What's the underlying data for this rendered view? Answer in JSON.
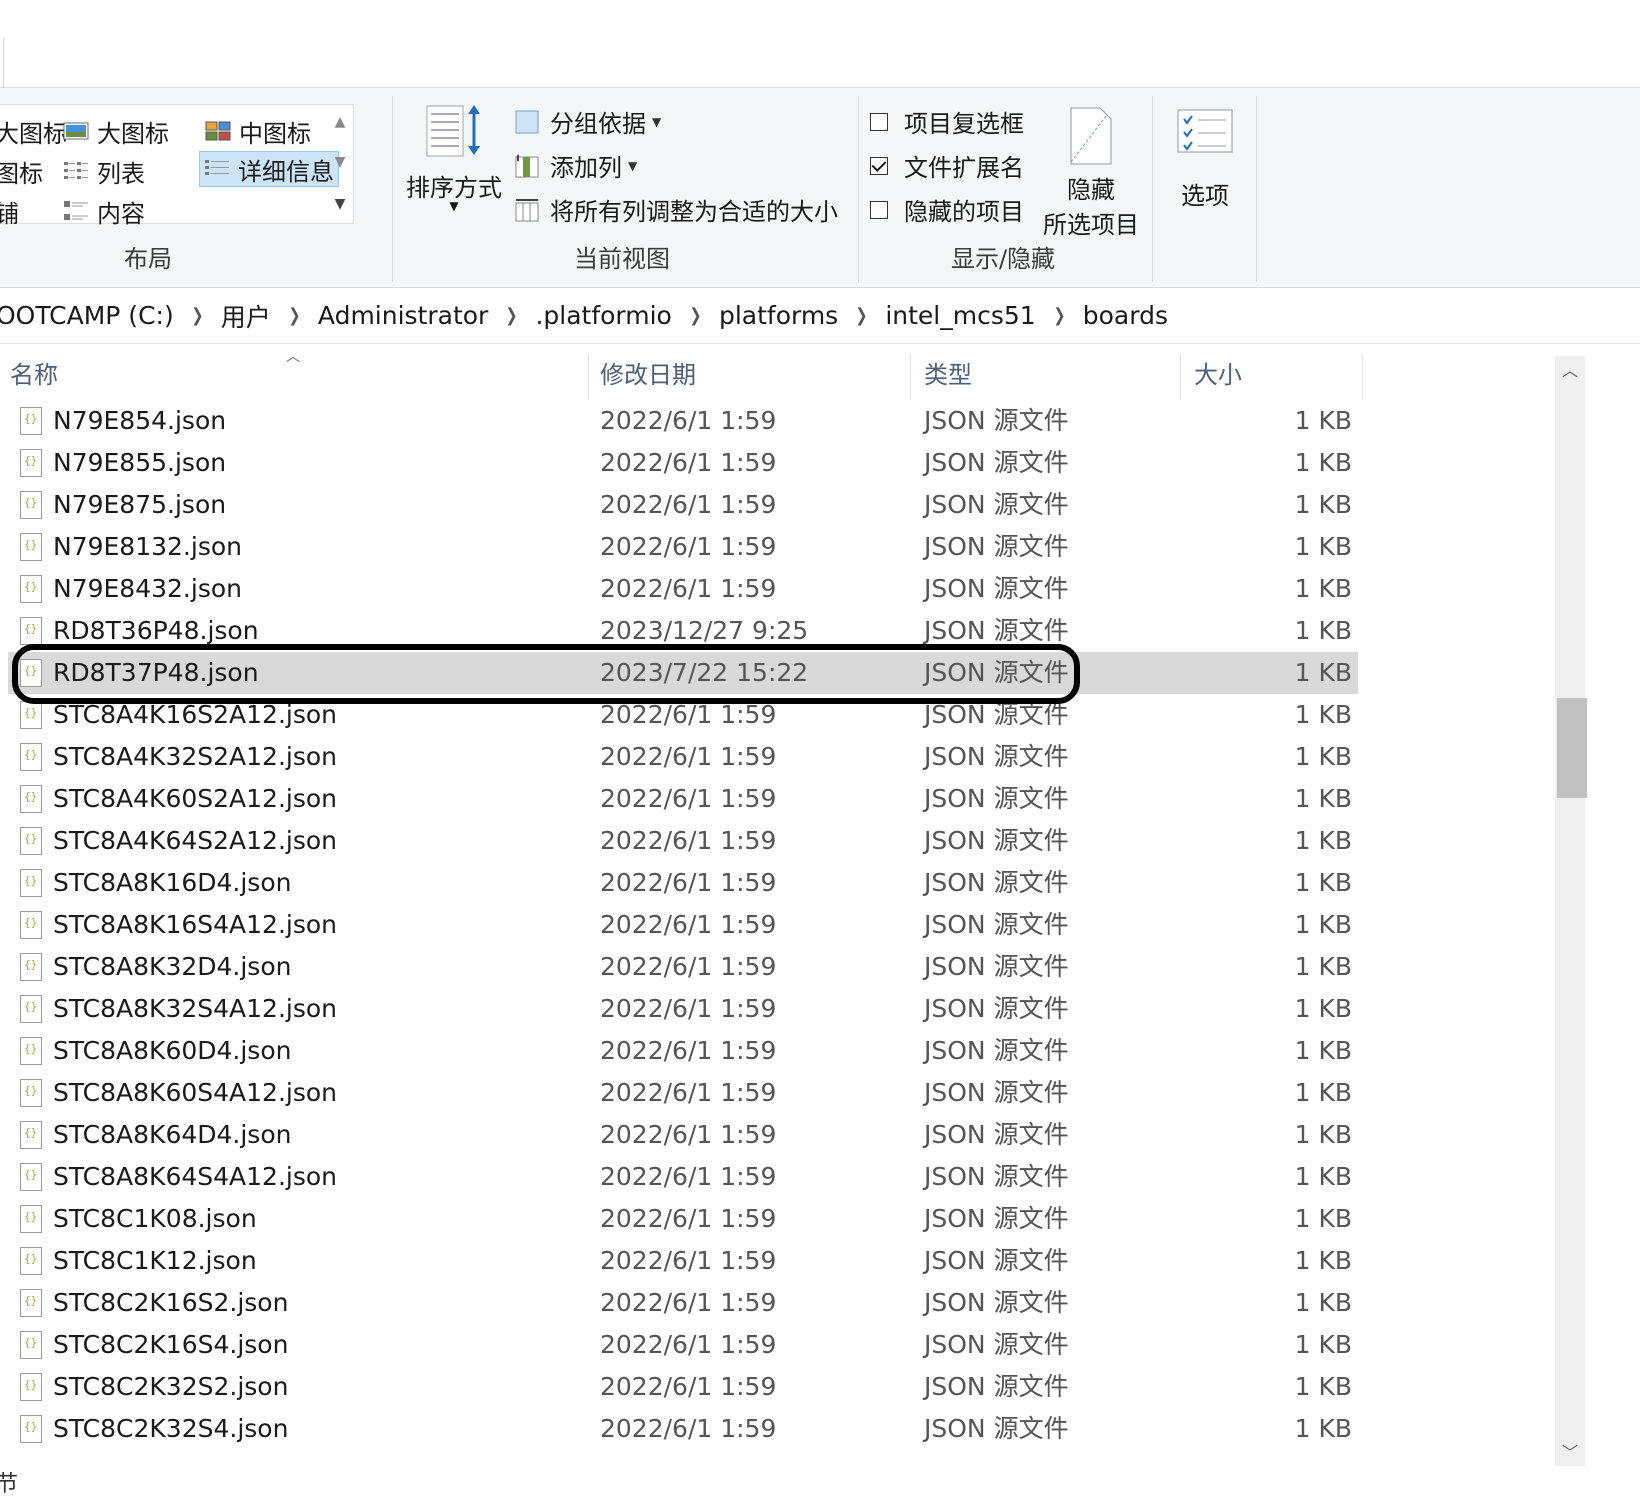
{
  "ribbon": {
    "layout": {
      "label": "布局",
      "items": {
        "partial_large": "大图标",
        "large": "大图标",
        "medium": "中图标",
        "partial_small": "图标",
        "list": "列表",
        "details": "详细信息",
        "partial_tiles": "铺",
        "content": "内容"
      }
    },
    "current_view": {
      "label": "当前视图",
      "sort_by": "排序方式",
      "group_by": "分组依据",
      "add_columns": "添加列",
      "size_all_columns": "将所有列调整为合适的大小"
    },
    "show_hide": {
      "label": "显示/隐藏",
      "item_checkboxes": {
        "label": "项目复选框",
        "checked": false
      },
      "file_extensions": {
        "label": "文件扩展名",
        "checked": true
      },
      "hidden_items": {
        "label": "隐藏的项目",
        "checked": false
      },
      "hide_selected_line1": "隐藏",
      "hide_selected_line2": "所选项目"
    },
    "options": {
      "label": "选项"
    }
  },
  "breadcrumb": [
    "OOTCAMP (C:)",
    "用户",
    "Administrator",
    ".platformio",
    "platforms",
    "intel_mcs51",
    "boards"
  ],
  "columns": {
    "name": "名称",
    "date": "修改日期",
    "type": "类型",
    "size": "大小"
  },
  "files": [
    {
      "name": "N79E854.json",
      "date": "2022/6/1 1:59",
      "type": "JSON 源文件",
      "size": "1 KB"
    },
    {
      "name": "N79E855.json",
      "date": "2022/6/1 1:59",
      "type": "JSON 源文件",
      "size": "1 KB"
    },
    {
      "name": "N79E875.json",
      "date": "2022/6/1 1:59",
      "type": "JSON 源文件",
      "size": "1 KB"
    },
    {
      "name": "N79E8132.json",
      "date": "2022/6/1 1:59",
      "type": "JSON 源文件",
      "size": "1 KB"
    },
    {
      "name": "N79E8432.json",
      "date": "2022/6/1 1:59",
      "type": "JSON 源文件",
      "size": "1 KB"
    },
    {
      "name": "RD8T36P48.json",
      "date": "2023/12/27 9:25",
      "type": "JSON 源文件",
      "size": "1 KB"
    },
    {
      "name": "RD8T37P48.json",
      "date": "2023/7/22 15:22",
      "type": "JSON 源文件",
      "size": "1 KB",
      "selected": true
    },
    {
      "name": "STC8A4K16S2A12.json",
      "date": "2022/6/1 1:59",
      "type": "JSON 源文件",
      "size": "1 KB"
    },
    {
      "name": "STC8A4K32S2A12.json",
      "date": "2022/6/1 1:59",
      "type": "JSON 源文件",
      "size": "1 KB"
    },
    {
      "name": "STC8A4K60S2A12.json",
      "date": "2022/6/1 1:59",
      "type": "JSON 源文件",
      "size": "1 KB"
    },
    {
      "name": "STC8A4K64S2A12.json",
      "date": "2022/6/1 1:59",
      "type": "JSON 源文件",
      "size": "1 KB"
    },
    {
      "name": "STC8A8K16D4.json",
      "date": "2022/6/1 1:59",
      "type": "JSON 源文件",
      "size": "1 KB"
    },
    {
      "name": "STC8A8K16S4A12.json",
      "date": "2022/6/1 1:59",
      "type": "JSON 源文件",
      "size": "1 KB"
    },
    {
      "name": "STC8A8K32D4.json",
      "date": "2022/6/1 1:59",
      "type": "JSON 源文件",
      "size": "1 KB"
    },
    {
      "name": "STC8A8K32S4A12.json",
      "date": "2022/6/1 1:59",
      "type": "JSON 源文件",
      "size": "1 KB"
    },
    {
      "name": "STC8A8K60D4.json",
      "date": "2022/6/1 1:59",
      "type": "JSON 源文件",
      "size": "1 KB"
    },
    {
      "name": "STC8A8K60S4A12.json",
      "date": "2022/6/1 1:59",
      "type": "JSON 源文件",
      "size": "1 KB"
    },
    {
      "name": "STC8A8K64D4.json",
      "date": "2022/6/1 1:59",
      "type": "JSON 源文件",
      "size": "1 KB"
    },
    {
      "name": "STC8A8K64S4A12.json",
      "date": "2022/6/1 1:59",
      "type": "JSON 源文件",
      "size": "1 KB"
    },
    {
      "name": "STC8C1K08.json",
      "date": "2022/6/1 1:59",
      "type": "JSON 源文件",
      "size": "1 KB"
    },
    {
      "name": "STC8C1K12.json",
      "date": "2022/6/1 1:59",
      "type": "JSON 源文件",
      "size": "1 KB"
    },
    {
      "name": "STC8C2K16S2.json",
      "date": "2022/6/1 1:59",
      "type": "JSON 源文件",
      "size": "1 KB"
    },
    {
      "name": "STC8C2K16S4.json",
      "date": "2022/6/1 1:59",
      "type": "JSON 源文件",
      "size": "1 KB"
    },
    {
      "name": "STC8C2K32S2.json",
      "date": "2022/6/1 1:59",
      "type": "JSON 源文件",
      "size": "1 KB"
    },
    {
      "name": "STC8C2K32S4.json",
      "date": "2022/6/1 1:59",
      "type": "JSON 源文件",
      "size": "1 KB"
    }
  ],
  "status": {
    "partial_text": "节"
  },
  "colors": {
    "selected_row": "#d9d9d9",
    "selected_view_bg": "#cce4f7",
    "highlight_ring": "#000000"
  }
}
